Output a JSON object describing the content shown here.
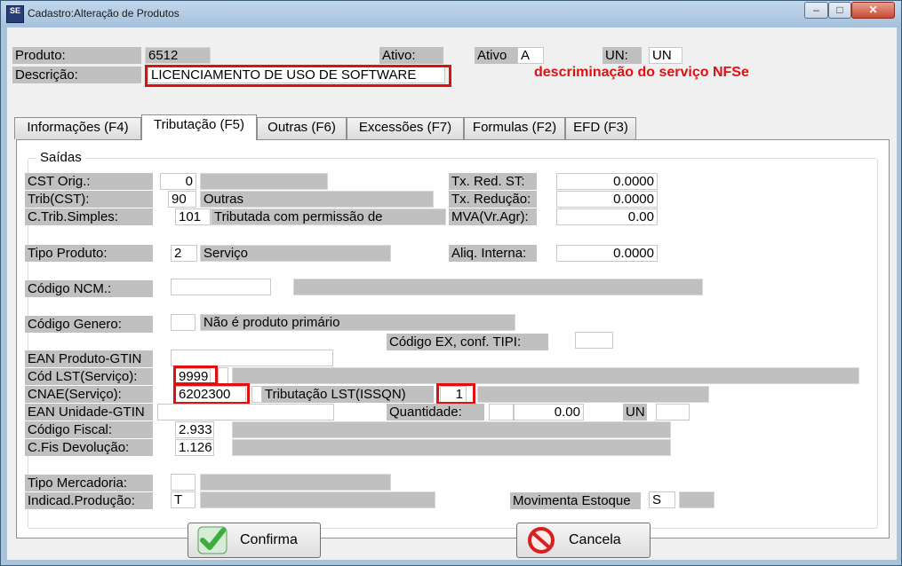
{
  "window": {
    "title": "Cadastro:Alteração de Produtos",
    "app_icon_text": "SE",
    "min_symbol": "–",
    "max_symbol": "□",
    "close_symbol": "✕"
  },
  "header": {
    "produto_label": "Produto:",
    "produto_value": "6512",
    "ativo_label": "Ativo:",
    "ativo_label2": "Ativo",
    "ativo_value": "A",
    "un_label": "UN:",
    "un_value": "UN",
    "descricao_label": "Descrição:",
    "descricao_value": "LICENCIAMENTO DE USO DE  SOFTWARE",
    "annotation": "descriminação do serviço NFSe"
  },
  "tabs": [
    {
      "label": "Informações (F4)"
    },
    {
      "label": "Tributação (F5)"
    },
    {
      "label": "Outras (F6)"
    },
    {
      "label": "Excessões (F7)"
    },
    {
      "label": "Formulas (F2)"
    },
    {
      "label": "EFD (F3)"
    }
  ],
  "form": {
    "group_title": "Saídas",
    "cst_orig_label": "CST Orig.:",
    "cst_orig_value": "0",
    "trib_cst_label": "Trib(CST):",
    "trib_cst_value": "90",
    "trib_cst_desc": "Outras",
    "ctrib_simples_label": "C.Trib.Simples:",
    "ctrib_simples_value": "101",
    "ctrib_simples_desc": "Tributada com permissão de",
    "tx_red_st_label": "Tx. Red. ST:",
    "tx_red_st_value": "0.0000",
    "tx_reducao_label": "Tx. Redução:",
    "tx_reducao_value": "0.0000",
    "mva_label": "MVA(Vr.Agr):",
    "mva_value": "0.00",
    "tipo_produto_label": "Tipo Produto:",
    "tipo_produto_value": "2",
    "tipo_produto_desc": "Serviço",
    "aliq_interna_label": "Aliq. Interna:",
    "aliq_interna_value": "0.0000",
    "ncm_label": "Código NCM.:",
    "genero_label": "Código Genero:",
    "genero_desc": "Não é produto primário",
    "codigo_ex_label": "Código EX, conf. TIPI:",
    "ean_gtin_label": "EAN Produto-GTIN",
    "cod_lst_label": "Cód LST(Serviço):",
    "cod_lst_value": "9999",
    "cnae_label": "CNAE(Serviço):",
    "cnae_value": "6202300",
    "trib_lst_label": "Tributação LST(ISSQN)",
    "trib_lst_value": "1",
    "ean_unidade_label": "EAN Unidade-GTIN",
    "quantidade_label": "Quantidade:",
    "quantidade_value": "0.00",
    "quantidade_un": "UN",
    "codigo_fiscal_label": "Código Fiscal:",
    "codigo_fiscal_value": "2.933",
    "cfis_devolucao_label": "C.Fis Devolução:",
    "cfis_devolucao_value": "1.126",
    "tipo_mercadoria_label": "Tipo Mercadoria:",
    "indicad_producao_label": "Indicad.Produção:",
    "indicad_producao_value": "T",
    "movimenta_estoque_label": "Movimenta Estoque",
    "movimenta_estoque_value": "S"
  },
  "buttons": {
    "confirma": "Confirma",
    "cancela": "Cancela"
  },
  "colors": {
    "highlight": "#e01010",
    "confirm_icon": "#3cae3c",
    "cancel_icon": "#d81e1e"
  }
}
